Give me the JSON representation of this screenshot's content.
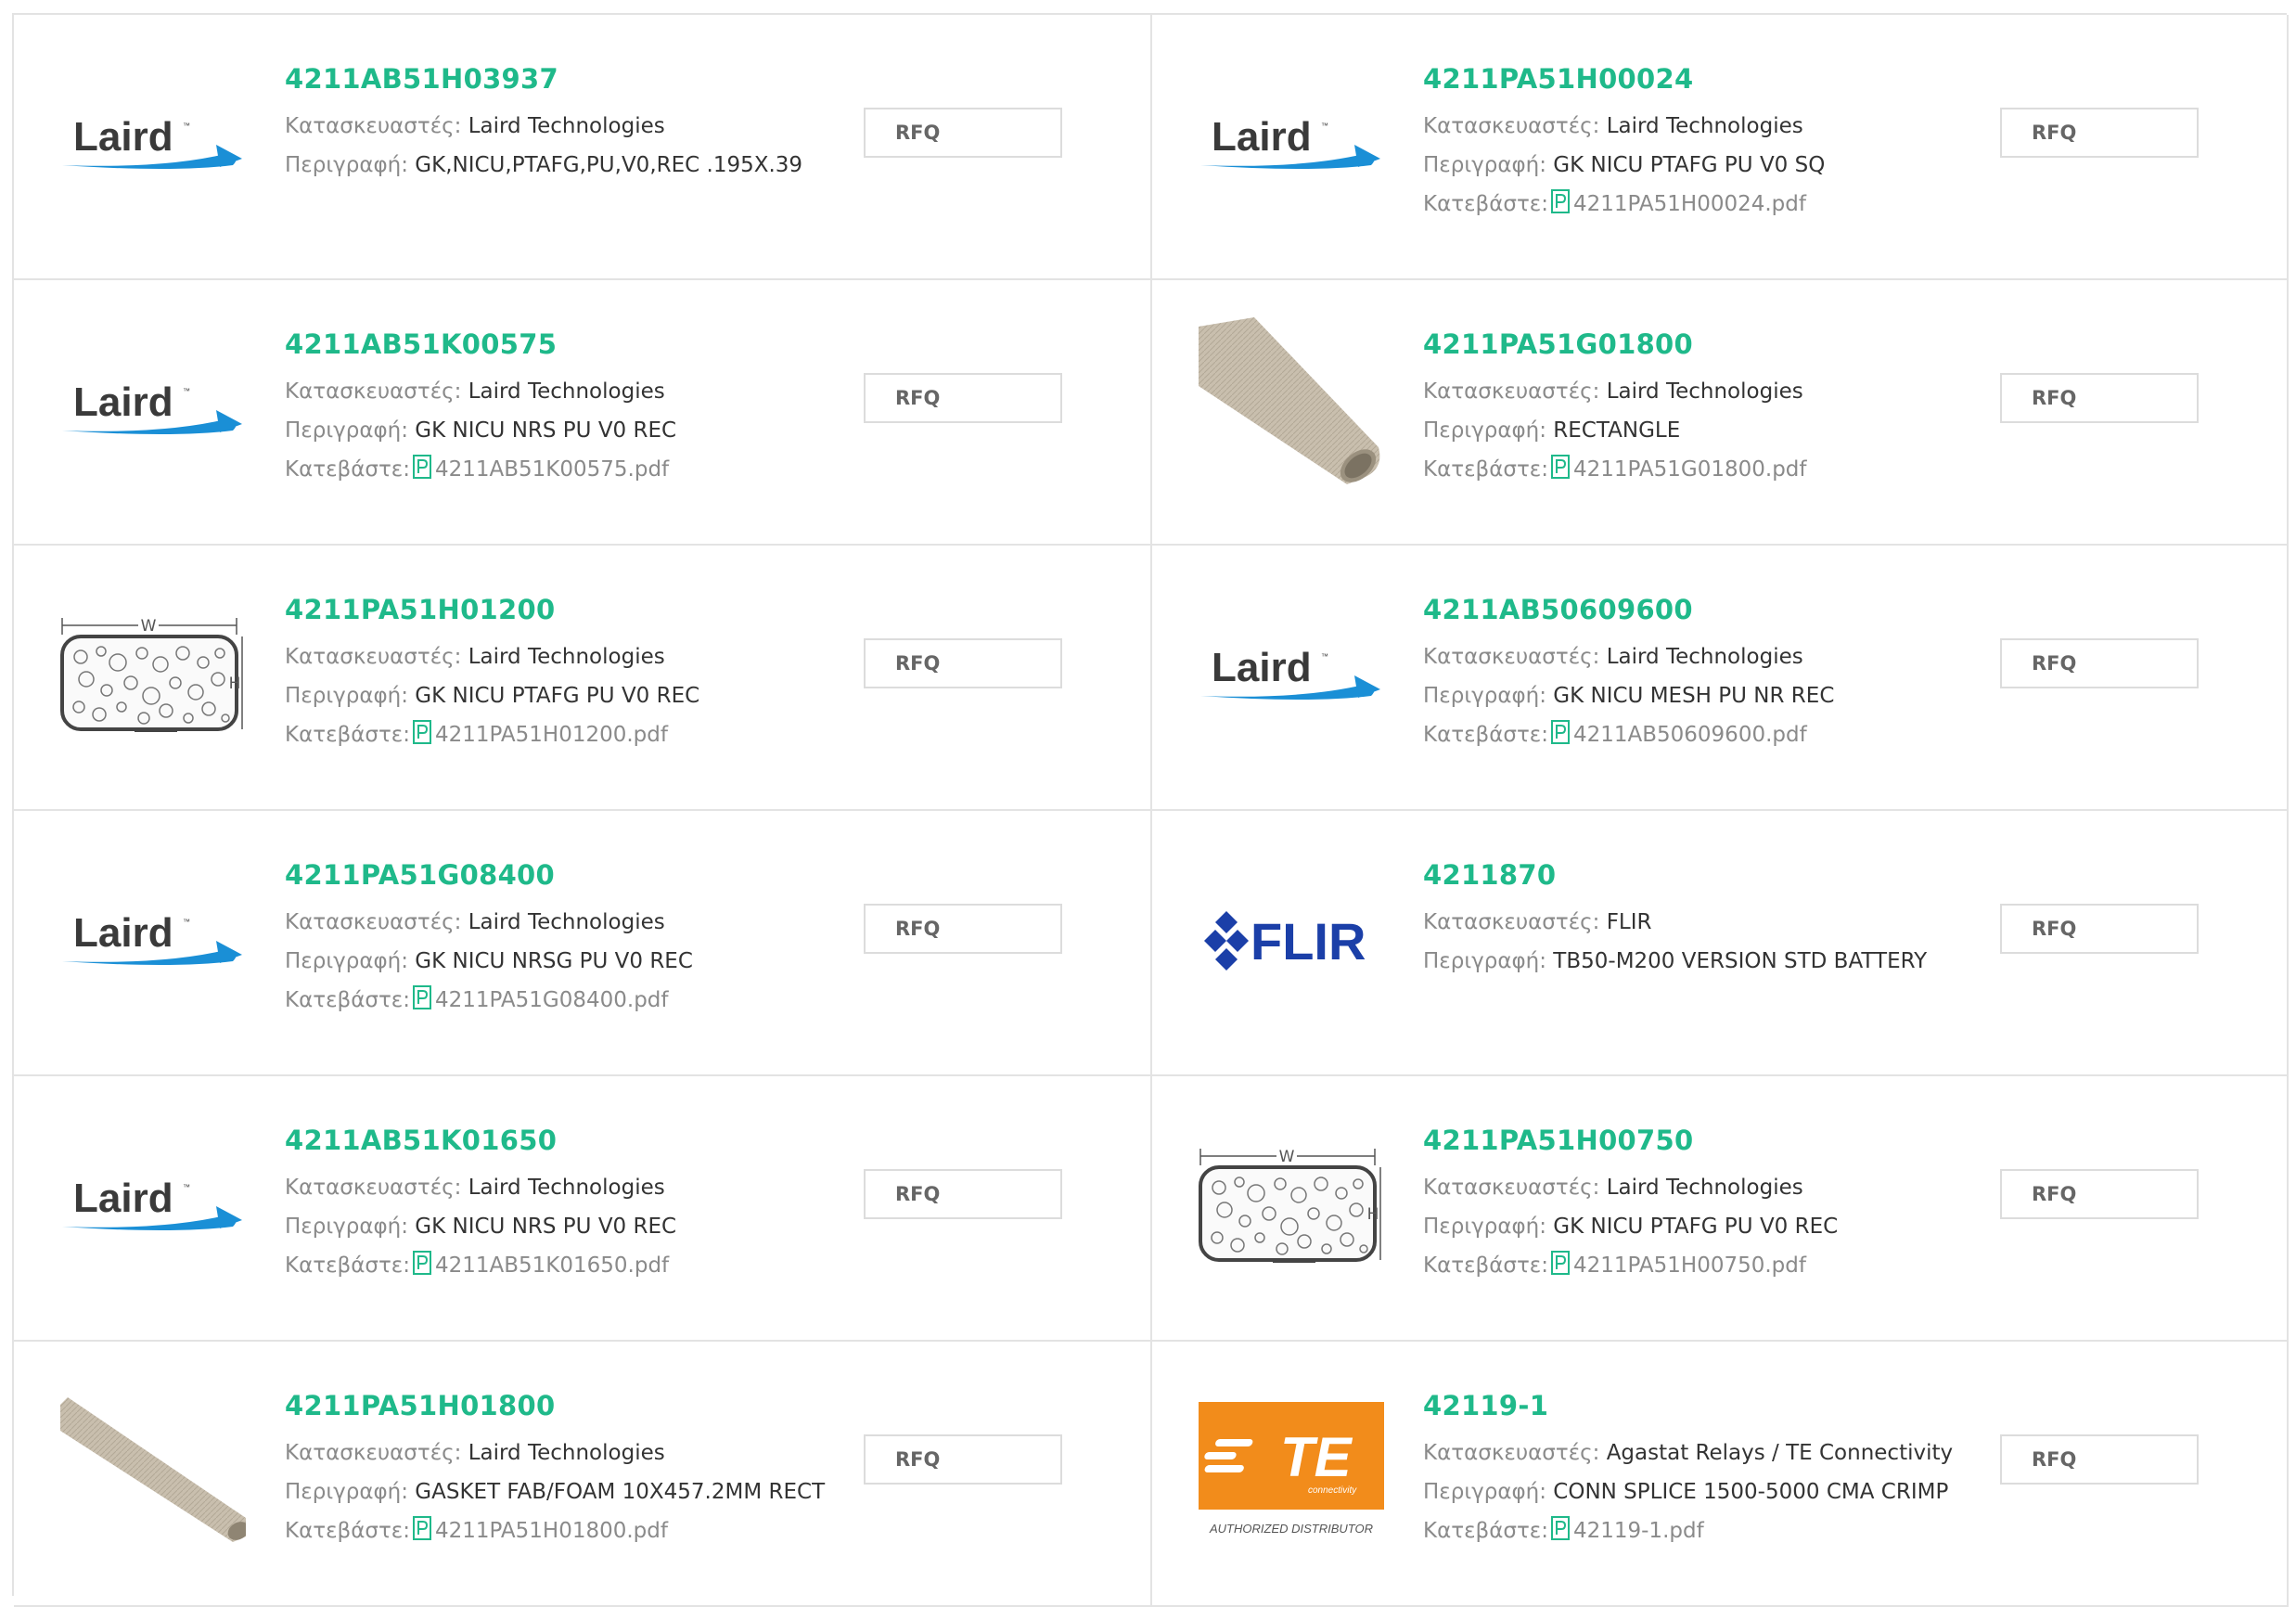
{
  "labels": {
    "manufacturer": "Κατασκευαστές:",
    "description": "Περιγραφή:",
    "download": "Κατεβάστε:",
    "rfq": "RFQ"
  },
  "logo_text": {
    "laird": "Laird",
    "flir": "FLIR",
    "te": "TE",
    "te_sub": "connectivity",
    "te_authorized": "AUTHORIZED DISTRIBUTOR",
    "dimension_w": "W",
    "dimension_h": "H"
  },
  "colors": {
    "part_number": "#1fb98a",
    "laird_blue": "#1a8fd6",
    "flir_blue": "#1b3fa8",
    "te_orange": "#f28c1b"
  },
  "products": [
    {
      "part": "4211AB51H03937",
      "manufacturer": "Laird Technologies",
      "description": "GK,NICU,PTAFG,PU,V0,REC .195X.39",
      "pdf": "",
      "image": "laird-logo"
    },
    {
      "part": "4211PA51H00024",
      "manufacturer": "Laird Technologies",
      "description": "GK NICU PTAFG PU V0 SQ",
      "pdf": "4211PA51H00024.pdf",
      "image": "laird-logo"
    },
    {
      "part": "4211AB51K00575",
      "manufacturer": "Laird Technologies",
      "description": "GK NICU NRS PU V0 REC",
      "pdf": "4211AB51K00575.pdf",
      "image": "laird-logo"
    },
    {
      "part": "4211PA51G01800",
      "manufacturer": "Laird Technologies",
      "description": "RECTANGLE",
      "pdf": "4211PA51G01800.pdf",
      "image": "gasket-photo-steep"
    },
    {
      "part": "4211PA51H01200",
      "manufacturer": "Laird Technologies",
      "description": "GK NICU PTAFG PU V0 REC",
      "pdf": "4211PA51H01200.pdf",
      "image": "foam-diagram"
    },
    {
      "part": "4211AB50609600",
      "manufacturer": "Laird Technologies",
      "description": "GK NICU MESH PU NR REC",
      "pdf": "4211AB50609600.pdf",
      "image": "laird-logo"
    },
    {
      "part": "4211PA51G08400",
      "manufacturer": "Laird Technologies",
      "description": "GK NICU NRSG PU V0 REC",
      "pdf": "4211PA51G08400.pdf",
      "image": "laird-logo"
    },
    {
      "part": "4211870",
      "manufacturer": "FLIR",
      "description": "TB50-M200 VERSION STD BATTERY",
      "pdf": "",
      "image": "flir-logo"
    },
    {
      "part": "4211AB51K01650",
      "manufacturer": "Laird Technologies",
      "description": "GK NICU NRS PU V0 REC",
      "pdf": "4211AB51K01650.pdf",
      "image": "laird-logo"
    },
    {
      "part": "4211PA51H00750",
      "manufacturer": "Laird Technologies",
      "description": "GK NICU PTAFG PU V0 REC",
      "pdf": "4211PA51H00750.pdf",
      "image": "foam-diagram"
    },
    {
      "part": "4211PA51H01800",
      "manufacturer": "Laird Technologies",
      "description": "GASKET FAB/FOAM 10X457.2MM RECT",
      "pdf": "4211PA51H01800.pdf",
      "image": "gasket-photo-flat"
    },
    {
      "part": "42119-1",
      "manufacturer": "Agastat Relays / TE Connectivity",
      "description": "CONN SPLICE 1500-5000 CMA CRIMP",
      "pdf": "42119-1.pdf",
      "image": "te-logo"
    }
  ]
}
